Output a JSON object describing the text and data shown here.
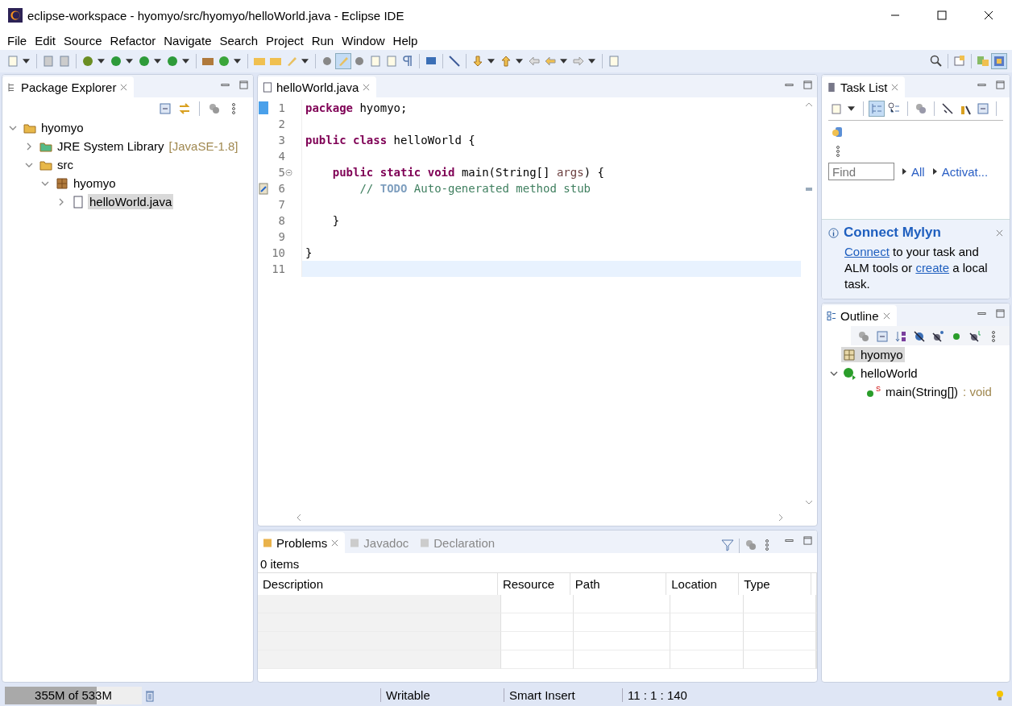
{
  "window": {
    "title": "eclipse-workspace - hyomyo/src/hyomyo/helloWorld.java - Eclipse IDE"
  },
  "menu": [
    "File",
    "Edit",
    "Source",
    "Refactor",
    "Navigate",
    "Search",
    "Project",
    "Run",
    "Window",
    "Help"
  ],
  "package_explorer": {
    "title": "Package Explorer",
    "tree": [
      {
        "label": "hyomyo",
        "kind": "project",
        "expanded": true,
        "selected": false,
        "children": [
          {
            "label": "JRE System Library",
            "decoration": "[JavaSE-1.8]",
            "kind": "library",
            "expanded": false,
            "selected": false
          },
          {
            "label": "src",
            "kind": "source",
            "expanded": true,
            "selected": false,
            "children": [
              {
                "label": "hyomyo",
                "kind": "package",
                "expanded": true,
                "selected": false,
                "children": [
                  {
                    "label": "helloWorld.java",
                    "kind": "file",
                    "expanded": false,
                    "selected": true
                  }
                ]
              }
            ]
          }
        ]
      }
    ]
  },
  "editor": {
    "tabs": [
      {
        "label": "helloWorld.java",
        "selected": true
      }
    ],
    "lines": [
      {
        "number": "1",
        "tokens": [
          {
            "kind": "keyword",
            "text": "package"
          },
          {
            "kind": "plain",
            "text": " hyomyo;"
          }
        ]
      },
      {
        "number": "2"
      },
      {
        "number": "3",
        "tokens": [
          {
            "kind": "keyword",
            "text": "public"
          },
          {
            "kind": "keyword",
            "text": " class"
          },
          {
            "kind": "plain",
            "text": " helloWorld {"
          }
        ]
      },
      {
        "number": "4"
      },
      {
        "number": "5",
        "fold": true,
        "tokens": [
          {
            "kind": "keyword",
            "text": "    public"
          },
          {
            "kind": "keyword",
            "text": " static"
          },
          {
            "kind": "keyword",
            "text": " void"
          },
          {
            "kind": "plain",
            "text": " main(String[] "
          },
          {
            "kind": "param",
            "text": "args"
          },
          {
            "kind": "plain",
            "text": ") {"
          }
        ]
      },
      {
        "number": "6",
        "task": true,
        "tokens": [
          {
            "kind": "comment",
            "text": "        // "
          },
          {
            "kind": "todo",
            "text": "TODO"
          },
          {
            "kind": "comment",
            "text": " Auto-generated method stub"
          }
        ]
      },
      {
        "number": "7"
      },
      {
        "number": "8",
        "tokens": [
          {
            "kind": "plain",
            "text": "    }"
          }
        ]
      },
      {
        "number": "9"
      },
      {
        "number": "10",
        "tokens": [
          {
            "kind": "plain",
            "text": "}"
          }
        ]
      },
      {
        "number": "11",
        "current": true
      }
    ]
  },
  "task_list": {
    "title": "Task List",
    "find": {
      "placeholder": "Find"
    },
    "filters": [
      "All",
      "Activat..."
    ],
    "mylyn": {
      "title": "Connect Mylyn",
      "parts": [
        {
          "text": "Connect",
          "link": true
        },
        {
          "text": " to your task and ALM tools or ",
          "link": false
        },
        {
          "text": "create",
          "link": true
        },
        {
          "text": " a local task.",
          "link": false
        }
      ]
    }
  },
  "outline": {
    "title": "Outline",
    "items": [
      {
        "label": "hyomyo",
        "kind": "package",
        "selected": true
      },
      {
        "label": "helloWorld",
        "kind": "class",
        "selected": false,
        "expanded": true,
        "children": [
          {
            "label": "main(String[])",
            "badge": "S",
            "type": " : void",
            "kind": "method",
            "selected": false
          }
        ]
      }
    ]
  },
  "bottom": {
    "tabs": [
      {
        "label": "Problems",
        "selected": true
      },
      {
        "label": "Javadoc",
        "selected": false
      },
      {
        "label": "Declaration",
        "selected": false
      }
    ],
    "summary": "0 items",
    "columns": [
      "Description",
      "Resource",
      "Path",
      "Location",
      "Type"
    ]
  },
  "status_bar": {
    "memory": {
      "text": "355M of 533M",
      "level": 0.67
    },
    "fields": [
      "Writable",
      "Smart Insert",
      "11 : 1 : 140"
    ]
  }
}
